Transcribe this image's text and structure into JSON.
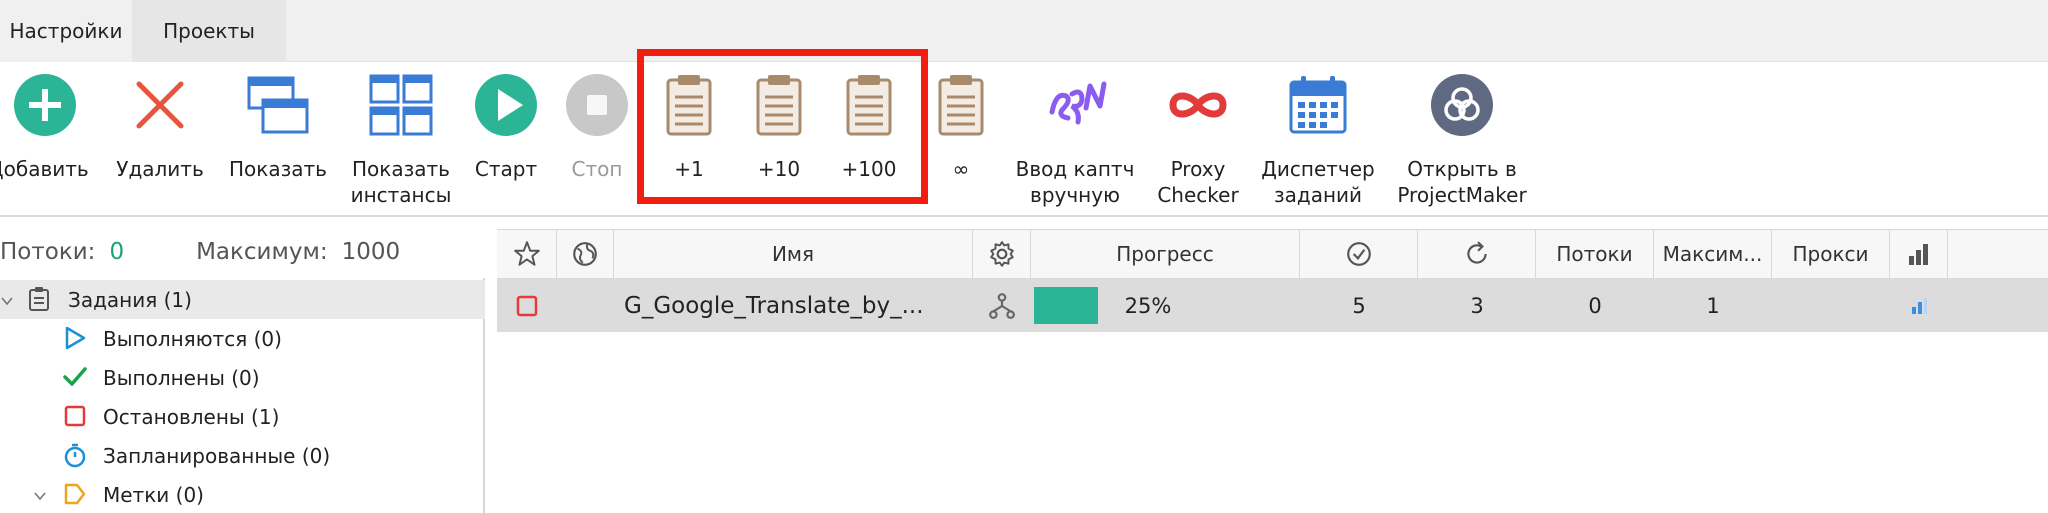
{
  "tabs": [
    {
      "label": "Настройки"
    },
    {
      "label": "Проекты"
    }
  ],
  "toolbar": {
    "add": "Добавить",
    "delete": "Удалить",
    "show": "Показать",
    "show_instances": "Показать\nинстансы",
    "start": "Старт",
    "stop": "Стоп",
    "plus1": "+1",
    "plus10": "+10",
    "plus100": "+100",
    "infinite": "∞",
    "captcha": "Ввод каптч\nвручную",
    "proxy_checker": "Proxy\nChecker",
    "task_manager": "Диспетчер\nзаданий",
    "open_projectmaker": "Открыть в\nProjectMaker"
  },
  "colors": {
    "add_green": "#2bb596",
    "delete_red": "#e8553e",
    "window_blue": "#3a7bd5",
    "start_green": "#2bb596",
    "stop_gray": "#c8c8c8",
    "clipboard_brown": "#a88a6c",
    "captcha_purple": "#8a5cf0",
    "proxy_red": "#e23b3b",
    "calendar_blue": "#3a7bd5",
    "projectmaker_slate": "#5f6a82",
    "highlight_red": "#f21f10",
    "progress_green": "#2bb596"
  },
  "status": {
    "threads_label": "Потоки:",
    "threads_value": "0",
    "max_label": "Максимум:",
    "max_value": "1000"
  },
  "tree": {
    "items": [
      {
        "label": "Задания (1)",
        "icon": "clipboard-icon"
      },
      {
        "label": "Выполняются (0)",
        "icon": "play-outline-icon"
      },
      {
        "label": "Выполнены (0)",
        "icon": "checkmark-icon"
      },
      {
        "label": "Остановлены (1)",
        "icon": "stop-square-icon"
      },
      {
        "label": "Запланированные (0)",
        "icon": "stopwatch-icon"
      },
      {
        "label": "Метки (0)",
        "icon": "tag-icon"
      }
    ]
  },
  "grid": {
    "headers": {
      "name": "Имя",
      "progress": "Прогресс",
      "threads": "Потоки",
      "max": "Максим...",
      "proxy": "Прокси"
    },
    "row": {
      "name": "G_Google_Translate_by_...",
      "progress_text": "25%",
      "progress": 0.25,
      "done": "5",
      "repeats": "3",
      "threads": "0",
      "max": "1",
      "proxy": ""
    }
  }
}
